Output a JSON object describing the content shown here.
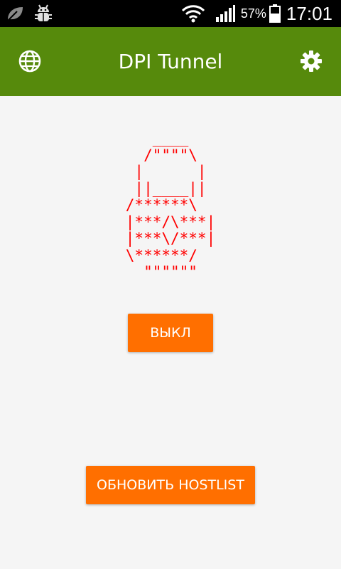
{
  "status_bar": {
    "left_icons": [
      "leaf-icon",
      "android-debug-icon"
    ],
    "battery_percent": "57%",
    "time": "17:01",
    "icons": [
      "wifi-icon",
      "signal-icon",
      "battery-icon"
    ]
  },
  "app_bar": {
    "title": "DPI Tunnel",
    "left_icon": "globe-icon",
    "right_icon": "gear-icon",
    "background_color": "#568a0c"
  },
  "main": {
    "lock_art": "   ____\n  /\"\"\"\"\\\n |      |\n ||____||\n/******\\\n|***/\\***|\n|***\\/***|\n\\******/\n  \"\"\"\"\"\"",
    "lock_color": "#ff0000",
    "toggle_button_label": "ВЫКЛ",
    "update_button_label": "ОБНОВИТЬ HOSTLIST",
    "button_color": "#ff6f00"
  }
}
